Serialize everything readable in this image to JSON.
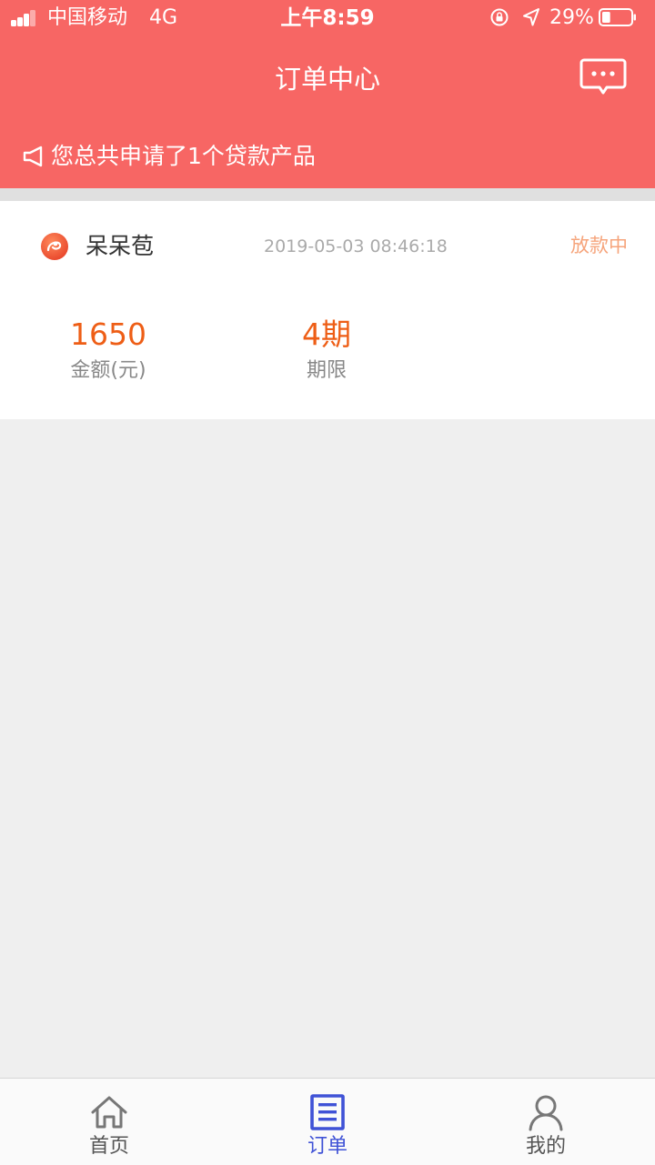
{
  "status_bar": {
    "carrier": "中国移动",
    "network": "4G",
    "time": "上午8:59",
    "battery": "29%",
    "battery_level": 0.29
  },
  "nav": {
    "title": "订单中心",
    "message_icon": "chat-bubble-icon"
  },
  "notice": {
    "icon": "megaphone-icon",
    "text": "您总共申请了1个贷款产品"
  },
  "order": {
    "product_name": "呆呆苞",
    "time": "2019-05-03 08:46:18",
    "status": "放款中",
    "amount_value": "1650",
    "amount_label": "金额(元)",
    "term_value": "4期",
    "term_label": "期限"
  },
  "colors": {
    "brand": "#f76664",
    "amount": "#ee5e16",
    "status": "#f6a47b",
    "tab_active": "#3f52d6"
  },
  "tabbar": {
    "items": [
      {
        "label": "首页",
        "icon": "home-icon",
        "active": false
      },
      {
        "label": "订单",
        "icon": "order-list-icon",
        "active": true
      },
      {
        "label": "我的",
        "icon": "user-icon",
        "active": false
      }
    ]
  }
}
